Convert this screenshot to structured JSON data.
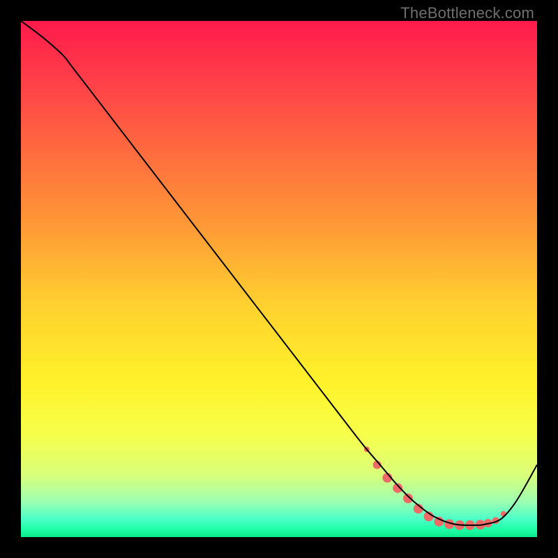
{
  "watermark": "TheBottleneck.com",
  "chart_data": {
    "type": "line",
    "title": "",
    "xlabel": "",
    "ylabel": "",
    "xlim": [
      0,
      100
    ],
    "ylim": [
      0,
      100
    ],
    "grid": false,
    "legend": false,
    "series": [
      {
        "name": "curve",
        "x": [
          0,
          4,
          8,
          10,
          15,
          20,
          25,
          30,
          35,
          40,
          45,
          50,
          55,
          60,
          65,
          67,
          70,
          73,
          76,
          80,
          84,
          88,
          90,
          93,
          96,
          100
        ],
        "y": [
          100,
          97,
          93.5,
          91,
          84.5,
          78,
          71.5,
          65,
          58.5,
          52,
          45.5,
          39,
          32.5,
          26,
          19.5,
          17,
          13.5,
          10,
          7,
          4,
          2.5,
          2.3,
          2.5,
          3.5,
          7,
          14
        ],
        "stroke": "#000000",
        "stroke_width": 2
      }
    ],
    "markers": {
      "name": "trough-dots",
      "color": "#ed6a66",
      "points": [
        {
          "x": 67,
          "y": 17,
          "r": 4
        },
        {
          "x": 69,
          "y": 14,
          "r": 6
        },
        {
          "x": 71,
          "y": 11.5,
          "r": 7
        },
        {
          "x": 73,
          "y": 9.5,
          "r": 7
        },
        {
          "x": 75,
          "y": 7.5,
          "r": 7
        },
        {
          "x": 77,
          "y": 5.5,
          "r": 7
        },
        {
          "x": 79,
          "y": 4,
          "r": 7
        },
        {
          "x": 81,
          "y": 3,
          "r": 7
        },
        {
          "x": 83,
          "y": 2.5,
          "r": 7
        },
        {
          "x": 85,
          "y": 2.3,
          "r": 7
        },
        {
          "x": 87,
          "y": 2.3,
          "r": 7
        },
        {
          "x": 89,
          "y": 2.4,
          "r": 7
        },
        {
          "x": 90.5,
          "y": 2.7,
          "r": 6
        },
        {
          "x": 92,
          "y": 3.2,
          "r": 5
        },
        {
          "x": 93.5,
          "y": 4.5,
          "r": 4
        }
      ]
    },
    "gradient_stops": [
      {
        "offset": 0.0,
        "color": "#ff1a4b"
      },
      {
        "offset": 0.1,
        "color": "#ff3a4a"
      },
      {
        "offset": 0.25,
        "color": "#ff6a3f"
      },
      {
        "offset": 0.4,
        "color": "#ff9a36"
      },
      {
        "offset": 0.55,
        "color": "#ffd12f"
      },
      {
        "offset": 0.7,
        "color": "#fff22a"
      },
      {
        "offset": 0.8,
        "color": "#f7ff4a"
      },
      {
        "offset": 0.88,
        "color": "#d9ff7a"
      },
      {
        "offset": 0.93,
        "color": "#9fffb0"
      },
      {
        "offset": 0.965,
        "color": "#4dffc8"
      },
      {
        "offset": 0.985,
        "color": "#1effa8"
      },
      {
        "offset": 1.0,
        "color": "#0bea88"
      }
    ]
  }
}
